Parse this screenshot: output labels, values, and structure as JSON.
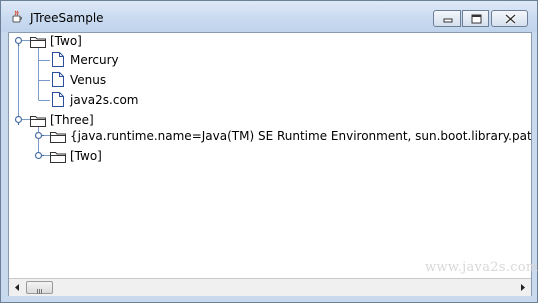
{
  "window": {
    "title": "JTreeSample",
    "icon": "java-cup-icon",
    "controls": [
      "minimize",
      "maximize",
      "close"
    ]
  },
  "tree": {
    "nodes": [
      {
        "label": "[Two]",
        "level": 0,
        "type": "folder",
        "expanded": true
      },
      {
        "label": "Mercury",
        "level": 1,
        "type": "leaf"
      },
      {
        "label": "Venus",
        "level": 1,
        "type": "leaf"
      },
      {
        "label": "java2s.com",
        "level": 1,
        "type": "leaf"
      },
      {
        "label": "[Three]",
        "level": 0,
        "type": "folder",
        "expanded": true
      },
      {
        "label": "{java.runtime.name=Java(TM) SE Runtime Environment, sun.boot.library.path=E:\\Jav",
        "level": 1,
        "type": "folder",
        "expanded": false
      },
      {
        "label": "[Two]",
        "level": 1,
        "type": "folder",
        "expanded": false
      }
    ]
  },
  "watermark": "www.java2s.com",
  "colors": {
    "title_gradient": "#cbdcf1",
    "tree_line": "#7a9cc6",
    "folder_stroke": "#333333"
  }
}
